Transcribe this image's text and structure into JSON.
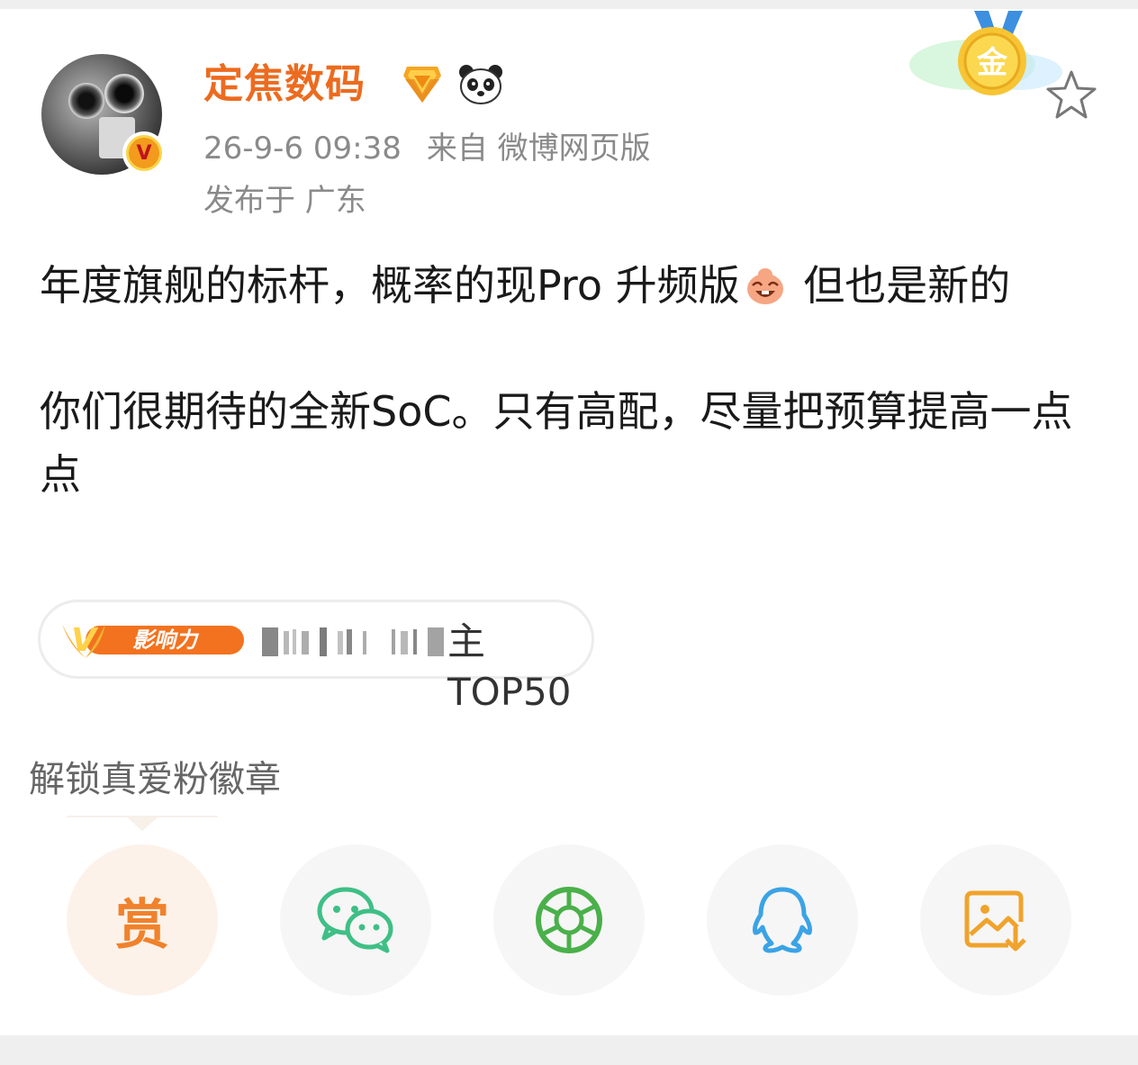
{
  "user": {
    "name": "定焦数码",
    "verified_mark": "V",
    "timestamp": "26-9-6 09:38",
    "source": "来自 微博网页版",
    "location": "发布于 广东"
  },
  "post": {
    "line1": "年度旗舰的标杆，概率的现Pro 升频版",
    "line1_tail": " 但也是新的",
    "line2": "你们很期待的全新SoC。只有高配，尽量把预算提高一点点"
  },
  "influence": {
    "badge_label": "影响力",
    "badge_letter": "V",
    "ranking_text": "主TOP50"
  },
  "fan_badge": {
    "label": "解锁真爱粉徽章"
  },
  "medal": {
    "label": "金"
  },
  "share": {
    "reward_label": "赏",
    "items": [
      "reward",
      "wechat",
      "moments",
      "qq",
      "save-image"
    ]
  },
  "colors": {
    "username": "#ec6b1f",
    "meta": "#8a8a8a",
    "reward": "#f0822c",
    "wechat": "#3fbf86",
    "moments": "#4ab04a",
    "qq": "#3ba3e6",
    "save": "#f0a32c"
  }
}
